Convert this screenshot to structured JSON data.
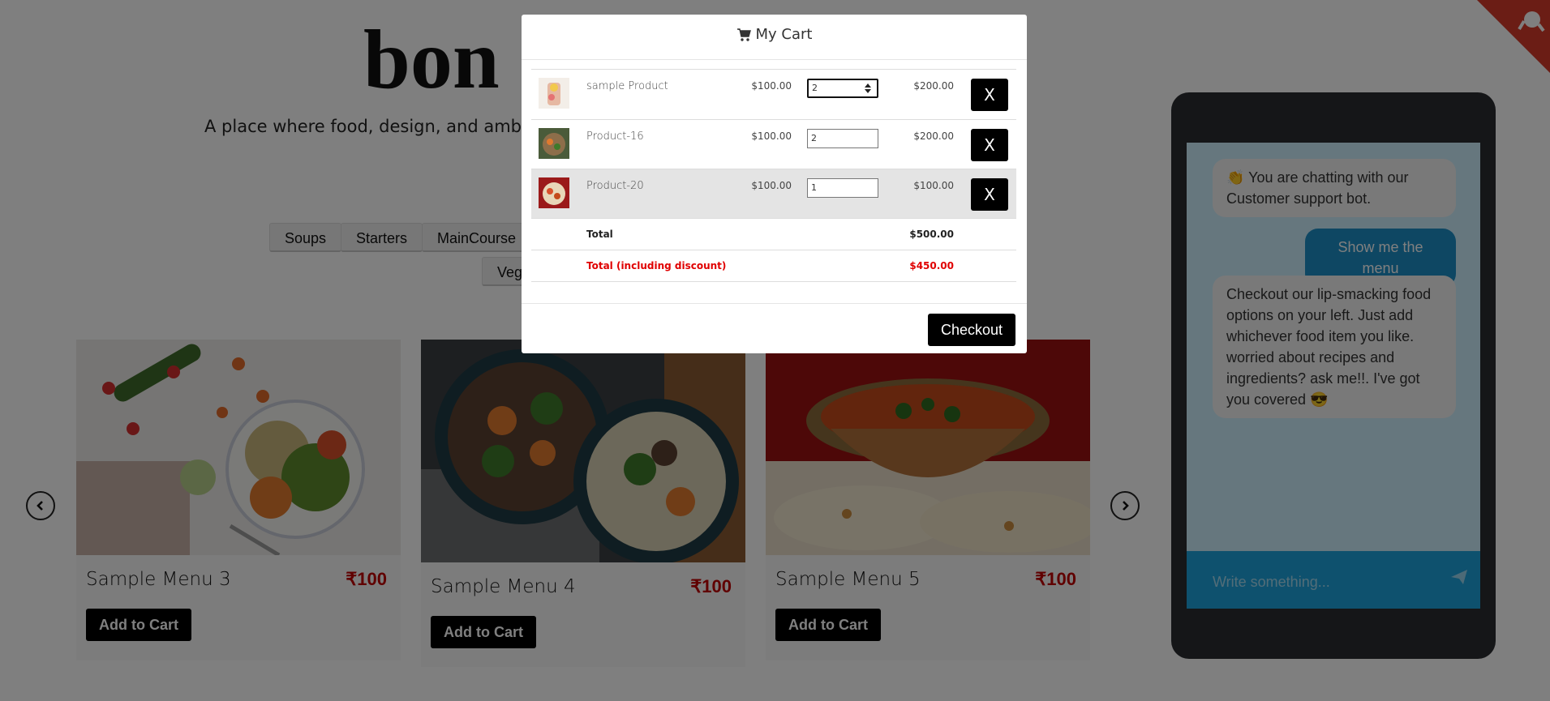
{
  "brand": {
    "title": "bon",
    "tagline": "A place where food, design, and ambic"
  },
  "categories": [
    "Soups",
    "Starters",
    "MainCourse",
    "Veg"
  ],
  "menu_items": [
    {
      "name": "Sample Menu 3",
      "price": "₹100",
      "button": "Add to Cart"
    },
    {
      "name": "Sample Menu 4",
      "price": "₹100",
      "button": "Add to Cart"
    },
    {
      "name": "Sample Menu 5",
      "price": "₹100",
      "button": "Add to Cart"
    }
  ],
  "chat": {
    "messages": [
      {
        "from": "bot",
        "text": "👏 You are chatting with our Customer support bot."
      },
      {
        "from": "user",
        "text": "Show me the menu"
      },
      {
        "from": "bot",
        "text": "Checkout our lip-smacking food options on your left. Just add whichever food item you like. worried about recipes and ingredients? ask me!!. I've got you covered 😎"
      }
    ],
    "input_placeholder": "Write something..."
  },
  "cart": {
    "title": "My Cart",
    "items": [
      {
        "name": "sample Product",
        "price": "$100.00",
        "qty": "2",
        "subtotal": "$200.00",
        "remove": "X"
      },
      {
        "name": "Product-16",
        "price": "$100.00",
        "qty": "2",
        "subtotal": "$200.00",
        "remove": "X"
      },
      {
        "name": "Product-20",
        "price": "$100.00",
        "qty": "1",
        "subtotal": "$100.00",
        "remove": "X"
      }
    ],
    "total_label": "Total",
    "total_value": "$500.00",
    "discount_label": "Total (including discount)",
    "discount_value": "$450.00",
    "checkout_label": "Checkout"
  },
  "colors": {
    "accent_red": "#e00000",
    "chat_blue": "#1d8fc6",
    "phone": "#2b2d31",
    "ribbon": "#d73a2a"
  }
}
